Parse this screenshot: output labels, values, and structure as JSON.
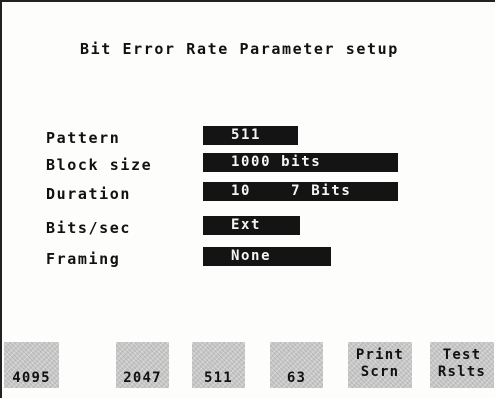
{
  "screen": {
    "title": "Bit Error Rate Parameter setup"
  },
  "parameters": [
    {
      "label": "Pattern",
      "value": "511"
    },
    {
      "label": "Block size",
      "value": "1000 bits"
    },
    {
      "label": "Duration",
      "value": "10    7 Bits"
    },
    {
      "label": "Bits/sec",
      "value": "Ext"
    },
    {
      "label": "Framing",
      "value": "None"
    }
  ],
  "softkeys": [
    {
      "lines": [
        "4095"
      ]
    },
    {
      "lines": [
        "2047"
      ]
    },
    {
      "lines": [
        "511"
      ]
    },
    {
      "lines": [
        "63"
      ]
    },
    {
      "lines": [
        "Print",
        "Scrn"
      ]
    },
    {
      "lines": [
        "Test",
        "Rslts"
      ]
    }
  ],
  "colors": {
    "background": "#fdfdfc",
    "field_background": "#141414",
    "field_text": "#f5f5f5",
    "softkey_background": "#c9c9c9",
    "text": "#111111"
  }
}
